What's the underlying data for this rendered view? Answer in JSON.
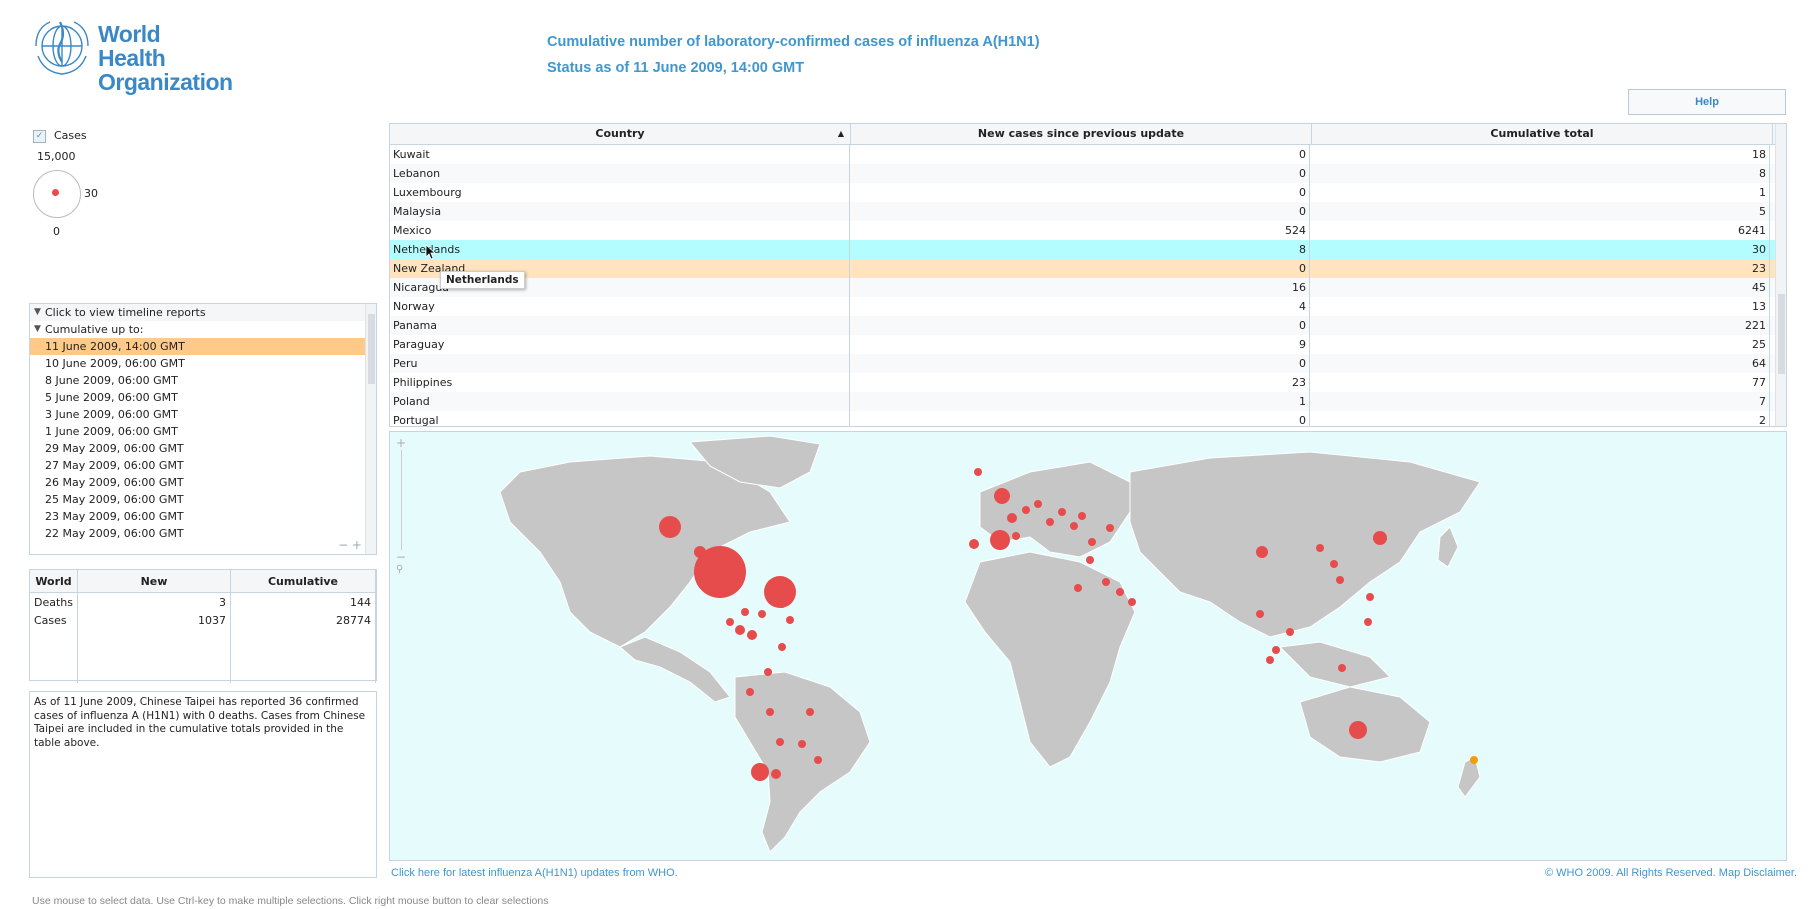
{
  "header": {
    "org_line1": "World Health",
    "org_line2": "Organization",
    "title": "Cumulative number of laboratory-confirmed cases of influenza A(H1N1)",
    "subtitle": "Status as of 11 June 2009, 14:00 GMT",
    "help_label": "Help"
  },
  "legend": {
    "checkbox_label": "Cases",
    "max_value": "15,000",
    "mid_value": "30",
    "min_value": "0",
    "checked": true
  },
  "timeline": {
    "section_label": "Click to view timeline reports",
    "group_label": "Cumulative up to:",
    "items": [
      "11 June 2009, 14:00 GMT",
      "10 June 2009, 06:00 GMT",
      "8 June 2009, 06:00 GMT",
      "5 June 2009, 06:00 GMT",
      "3 June 2009, 06:00 GMT",
      "1 June 2009, 06:00 GMT",
      "29 May 2009, 06:00 GMT",
      "27 May 2009, 06:00 GMT",
      "26 May 2009, 06:00 GMT",
      "25 May 2009, 06:00 GMT",
      "23 May 2009, 06:00 GMT",
      "22 May 2009, 06:00 GMT"
    ],
    "selected_index": 0,
    "controls": "− +"
  },
  "world_table": {
    "headers": [
      "World",
      "New",
      "Cumulative"
    ],
    "rows": [
      {
        "label": "Deaths",
        "new": "3",
        "cumulative": "144"
      },
      {
        "label": "Cases",
        "new": "1037",
        "cumulative": "28774"
      }
    ]
  },
  "note": "As of 11 June 2009, Chinese Taipei has reported 36 confirmed cases of influenza A (H1N1) with 0 deaths. Cases from Chinese Taipei are included in the cumulative totals provided in the table above.",
  "country_grid": {
    "headers": [
      "Country",
      "New cases since previous update",
      "Cumulative total"
    ],
    "sort_indicator": "▲",
    "rows": [
      {
        "country": "Kuwait",
        "new": "0",
        "total": "18"
      },
      {
        "country": "Lebanon",
        "new": "0",
        "total": "8"
      },
      {
        "country": "Luxembourg",
        "new": "0",
        "total": "1"
      },
      {
        "country": "Malaysia",
        "new": "0",
        "total": "5"
      },
      {
        "country": "Mexico",
        "new": "524",
        "total": "6241"
      },
      {
        "country": "Netherlands",
        "new": "8",
        "total": "30"
      },
      {
        "country": "New Zealand",
        "new": "0",
        "total": "23"
      },
      {
        "country": "Nicaragua",
        "new": "16",
        "total": "45"
      },
      {
        "country": "Norway",
        "new": "4",
        "total": "13"
      },
      {
        "country": "Panama",
        "new": "0",
        "total": "221"
      },
      {
        "country": "Paraguay",
        "new": "9",
        "total": "25"
      },
      {
        "country": "Peru",
        "new": "0",
        "total": "64"
      },
      {
        "country": "Philippines",
        "new": "23",
        "total": "77"
      },
      {
        "country": "Poland",
        "new": "1",
        "total": "7"
      },
      {
        "country": "Portugal",
        "new": "0",
        "total": "2"
      }
    ],
    "highlight_cyan_index": 5,
    "highlight_orange_index": 6
  },
  "tooltip": "Netherlands",
  "colors": {
    "accent": "#3f97cf",
    "case_dot": "#e74c4c",
    "selected_dot": "#f39c12",
    "map_sea": "#e6fbfc",
    "land": "#c6c6c6",
    "row_hover": "#b3fdff",
    "row_selected": "#ffe4bf"
  },
  "footer": {
    "link": "Click here for latest influenza A(H1N1) updates from WHO.",
    "copyright": "© WHO 2009. All Rights Reserved. Map Disclaimer.",
    "instructions": "Use mouse to select data.  Use Ctrl-key to make multiple selections.  Click right mouse button to clear selections"
  }
}
